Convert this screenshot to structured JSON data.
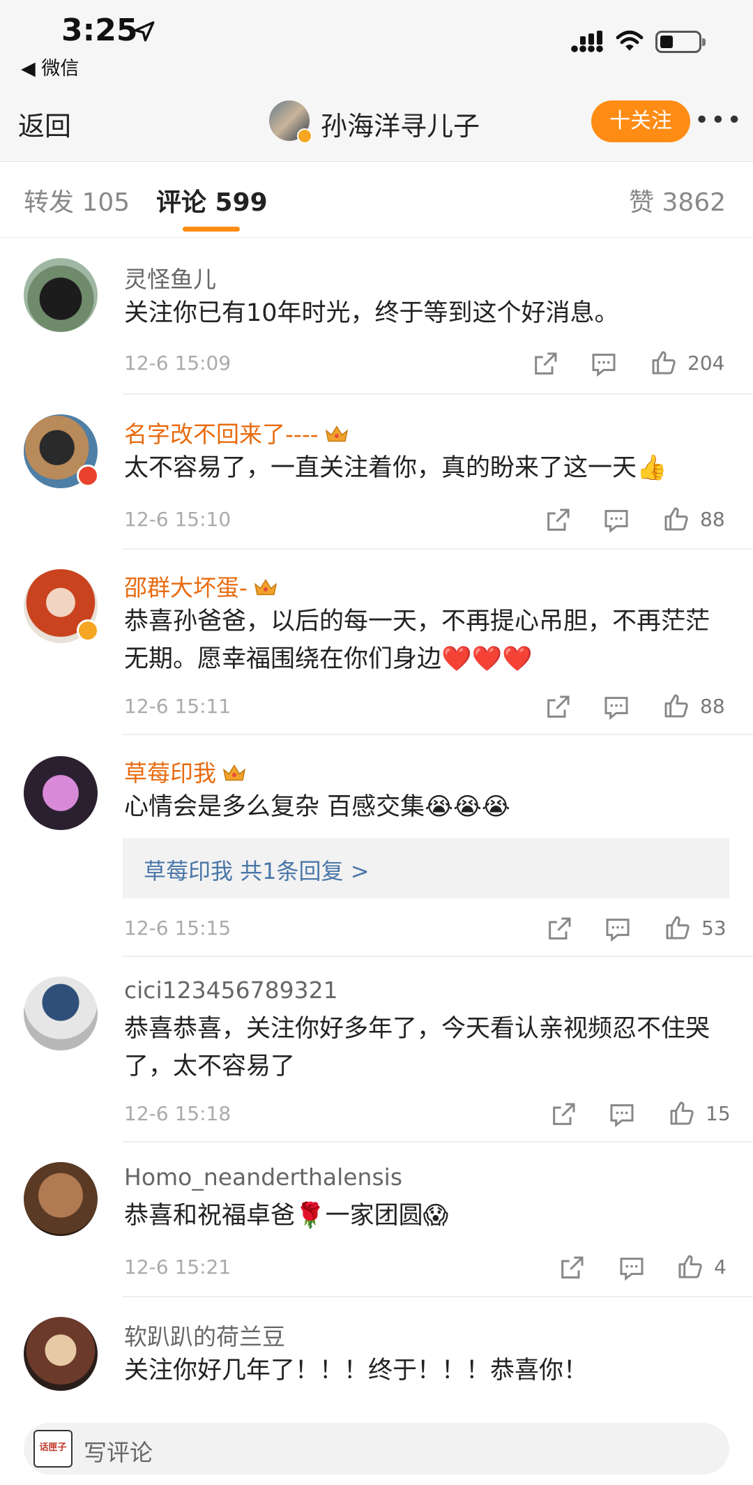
{
  "status_bar": {
    "time": "3:25",
    "back_app": "◀ 微信"
  },
  "nav": {
    "back": "返回",
    "title": "孙海洋寻儿子",
    "follow": "十关注",
    "more": "•••"
  },
  "tabs": [
    {
      "label": "转发 105"
    },
    {
      "label": "评论 599"
    },
    {
      "label": "赞 3862"
    }
  ],
  "comments": [
    {
      "name": "灵怪鱼儿",
      "text": "关注你已有10年时光，终于等到这个好消息。",
      "time": "12-6 15:09",
      "likes": "204"
    },
    {
      "name": "名字改不回来了----",
      "text": "太不容易了，一直关注着你，真的盼来了这一天👍",
      "time": "12-6 15:10",
      "likes": "88"
    },
    {
      "name": "邵群大坏蛋-",
      "text": "恭喜孙爸爸，以后的每一天，不再提心吊胆，不再茫茫无期。愿幸福围绕在你们身边❤️❤️❤️",
      "time": "12-6 15:11",
      "likes": "88"
    },
    {
      "name": "草莓印我",
      "text": "心情会是多么复杂 百感交集😭😭😭",
      "time": "12-6 15:15",
      "likes": "53",
      "reply": "草莓印我  共1条回复 >"
    },
    {
      "name": "cici123456789321",
      "text": "恭喜恭喜，关注你好多年了，今天看认亲视频忍不住哭了，太不容易了",
      "time": "12-6 15:18",
      "likes": "15"
    },
    {
      "name": "Homo_neanderthalensis",
      "text": "恭喜和祝福卓爸🌹一家团圆😱",
      "time": "12-6 15:21",
      "likes": "4"
    },
    {
      "name": "软趴趴的荷兰豆",
      "text": "关注你好几年了！！！终于！！！恭喜你！"
    }
  ],
  "bottom": {
    "placeholder": "写评论",
    "logo": "话匣子"
  },
  "colors": {
    "accent": "#ff8c14",
    "vip_name": "#e86b0f",
    "reply_link": "#4a76a8"
  }
}
